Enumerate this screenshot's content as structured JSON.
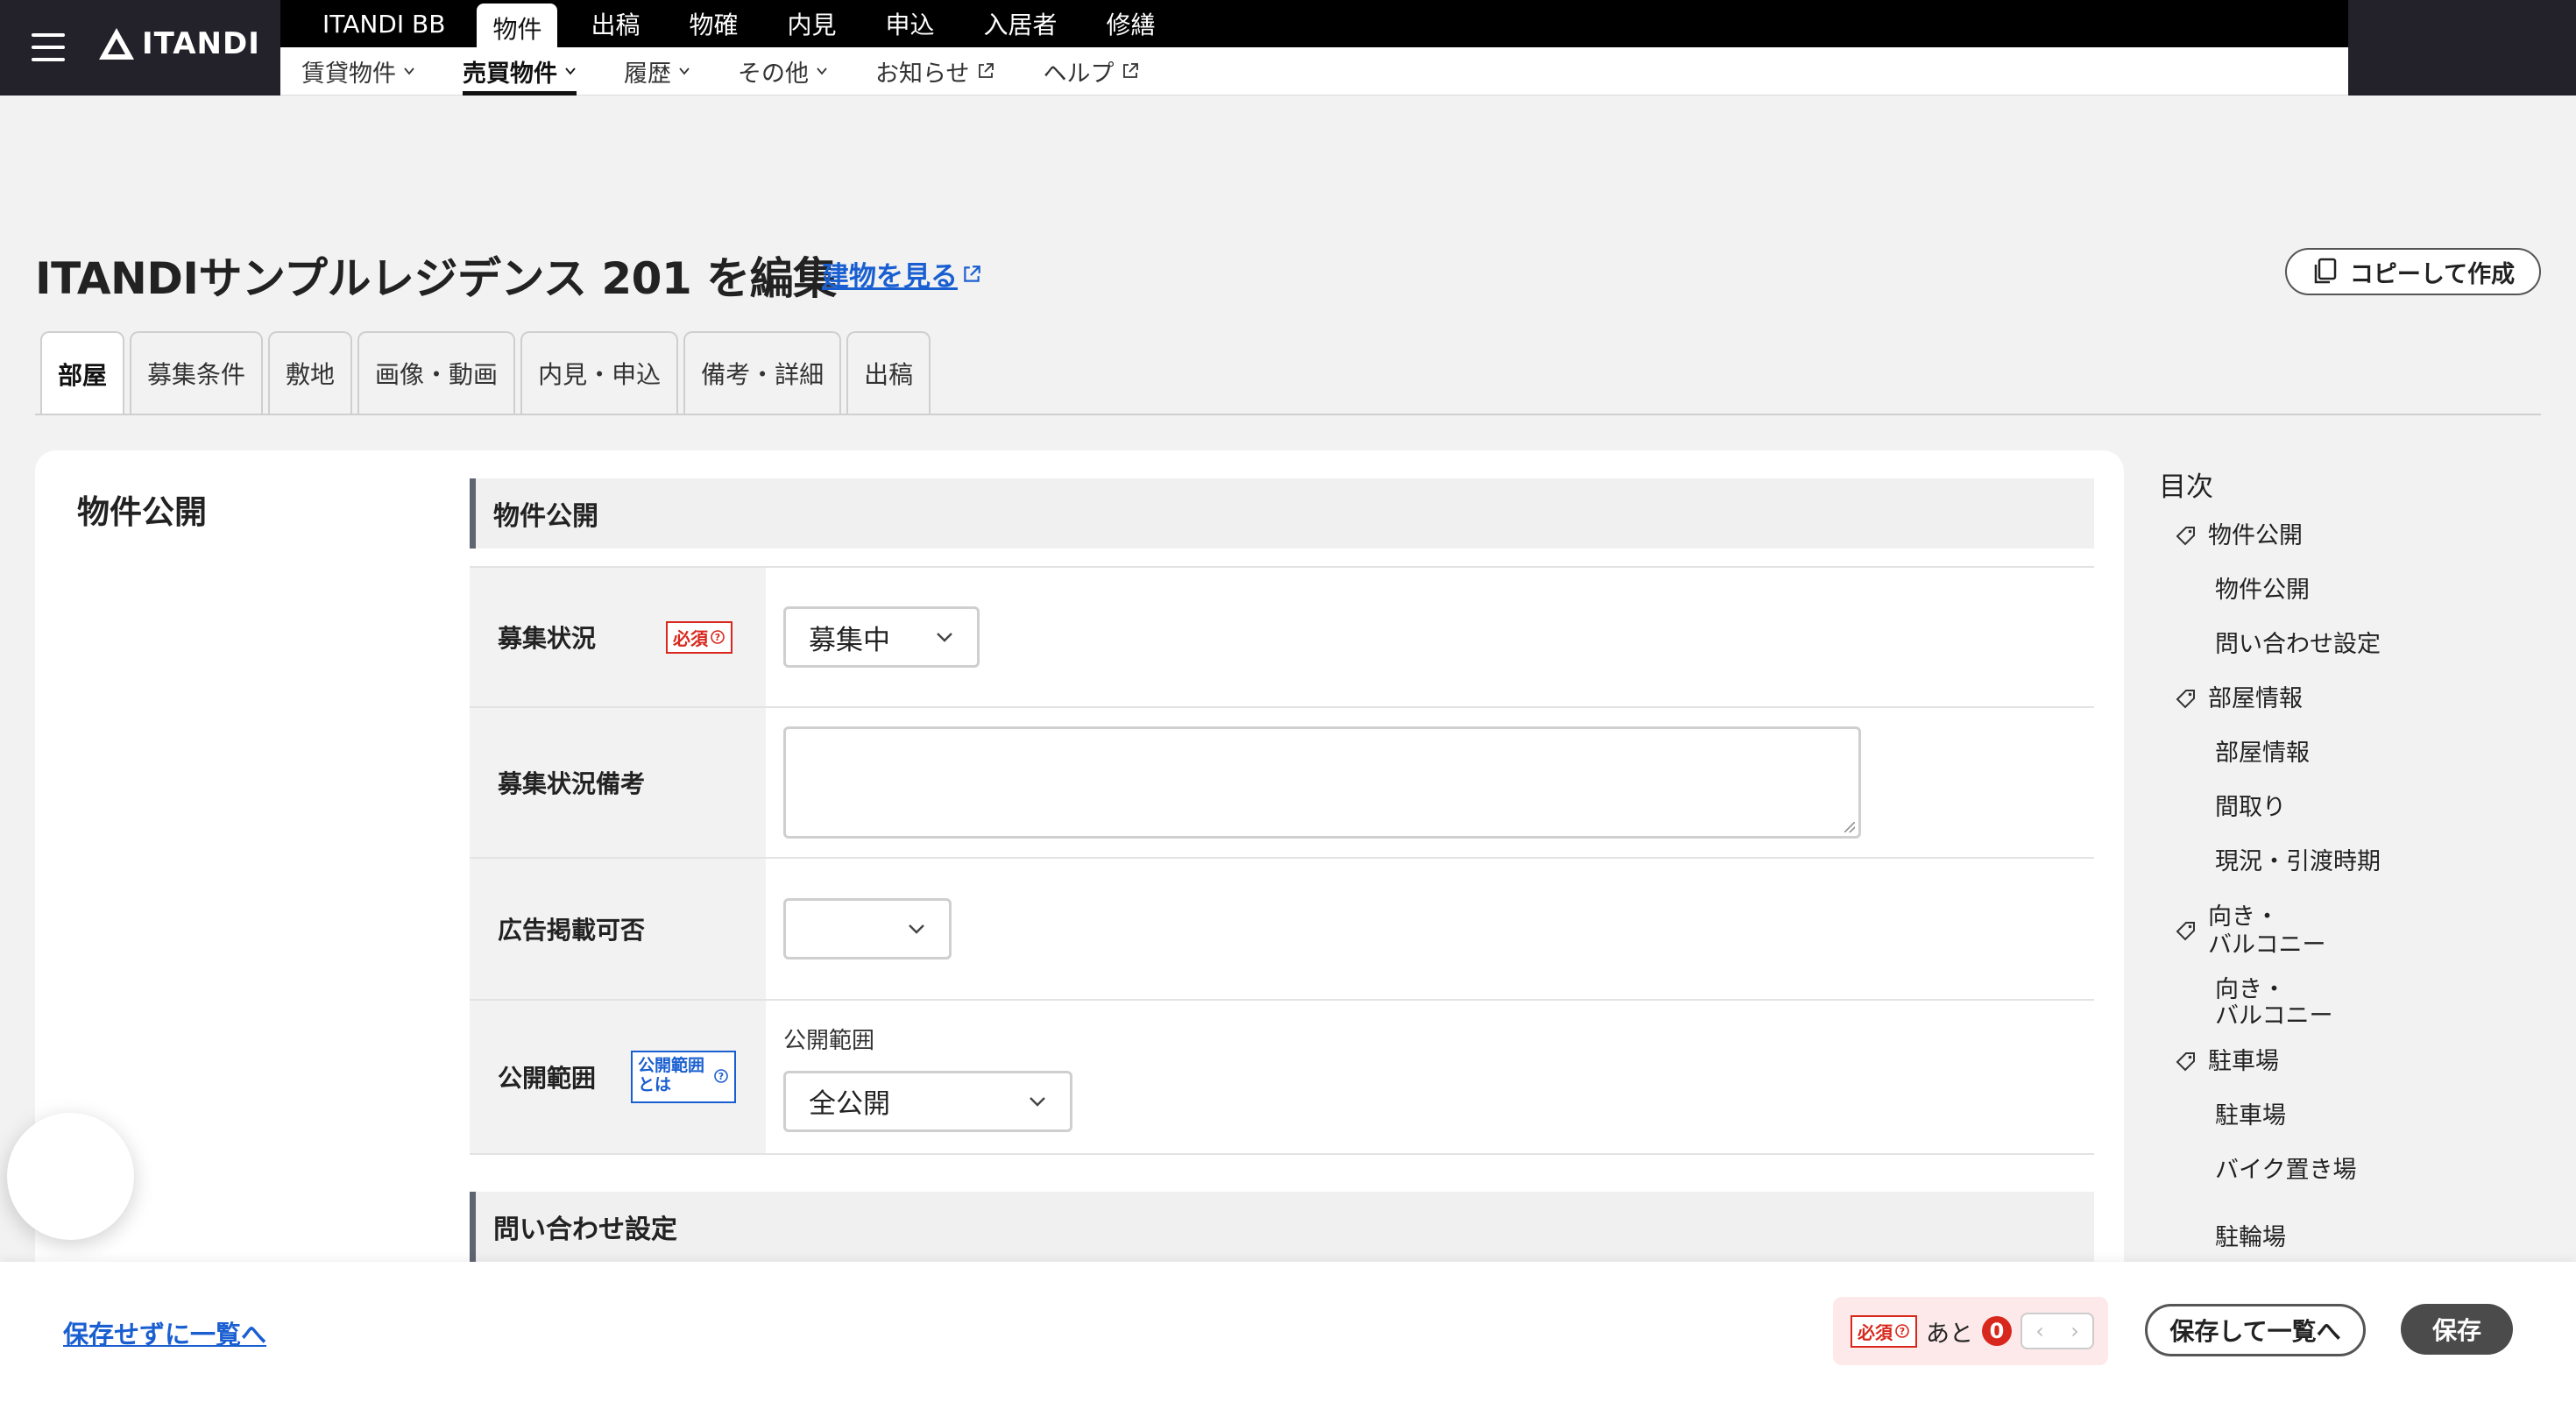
{
  "header": {
    "logo_text": "ITANDI",
    "product": "ITANDI BB",
    "top_nav": [
      "物件",
      "出稿",
      "物確",
      "内見",
      "申込",
      "入居者",
      "修繕"
    ],
    "top_nav_active": "物件",
    "sub_nav": [
      {
        "label": "賃貸物件",
        "icon": "chevron-down-icon"
      },
      {
        "label": "売買物件",
        "icon": "chevron-down-icon"
      },
      {
        "label": "履歴",
        "icon": "chevron-down-icon"
      },
      {
        "label": "その他",
        "icon": "chevron-down-icon"
      },
      {
        "label": "お知らせ",
        "icon": "external-link-icon"
      },
      {
        "label": "ヘルプ",
        "icon": "external-link-icon"
      }
    ],
    "sub_nav_active": "売買物件"
  },
  "page": {
    "title": "ITANDIサンプルレジデンス 201 を編集",
    "building_link": "建物を見る",
    "copy_button": "コピーして作成"
  },
  "tabs": [
    "部屋",
    "募集条件",
    "敷地",
    "画像・動画",
    "内見・申込",
    "備考・詳細",
    "出稿"
  ],
  "active_tab": "部屋",
  "main": {
    "section_label": "物件公開",
    "section1_heading": "物件公開",
    "section2_heading": "問い合わせ設定",
    "rows": {
      "status_label": "募集状況",
      "status_required": "必須",
      "status_value": "募集中",
      "status_note_label": "募集状況備考",
      "status_note_value": "",
      "ad_label": "広告掲載可否",
      "ad_value": "",
      "scope_label": "公開範囲",
      "scope_badge_line1": "公開範囲",
      "scope_badge_line2": "とは",
      "scope_caption": "公開範囲",
      "scope_value": "全公開"
    }
  },
  "toc": {
    "title": "目次",
    "g1": "物件公開",
    "g1_items": [
      "物件公開",
      "問い合わせ設定"
    ],
    "g2": "部屋情報",
    "g2_items": [
      "部屋情報",
      "間取り",
      "現況・引渡時期"
    ],
    "g3_line1": "向き・",
    "g3_line2": "バルコニー",
    "g3_item_line1": "向き・",
    "g3_item_line2": "バルコニー",
    "g4": "駐車場",
    "g4_items": [
      "駐車場",
      "バイク置き場"
    ],
    "g4_cut": "駐輪場"
  },
  "footer": {
    "back_link": "保存せずに一覧へ",
    "required_badge": "必須",
    "remaining_text": "あと",
    "remaining_count": "0",
    "prev": "‹",
    "next": "›",
    "save_and_list": "保存して一覧へ",
    "save": "保存"
  },
  "colors": {
    "header_dark": "#232129",
    "link_blue": "#1a5fd1",
    "required_red": "#d8271c",
    "save_button": "#4b4b4b"
  }
}
